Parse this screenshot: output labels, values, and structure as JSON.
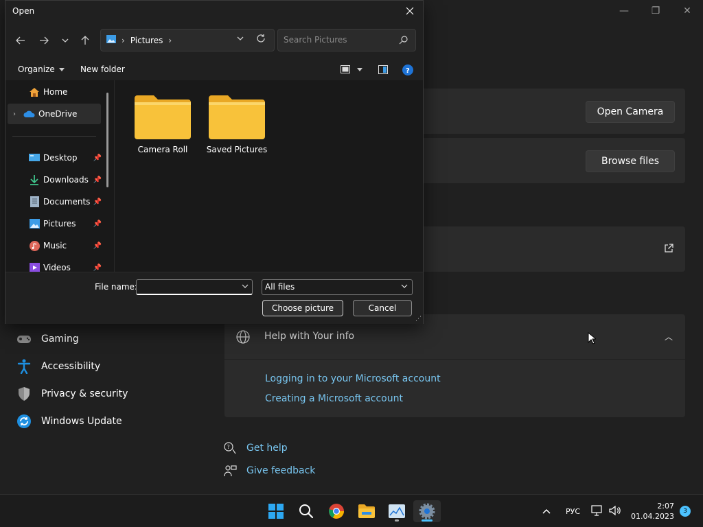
{
  "settings": {
    "window_controls": {
      "minimize": "—",
      "maximize": "❐",
      "close": "✕"
    },
    "open_camera_label": "Open Camera",
    "browse_files_label": "Browse files",
    "nav": [
      {
        "label": "Gaming",
        "icon": "gamepad-icon"
      },
      {
        "label": "Accessibility",
        "icon": "accessibility-icon"
      },
      {
        "label": "Privacy & security",
        "icon": "shield-icon"
      },
      {
        "label": "Windows Update",
        "icon": "update-icon"
      }
    ],
    "help": {
      "title": "Help with Your info",
      "links": [
        "Logging in to your Microsoft account",
        "Creating a Microsoft account"
      ]
    },
    "get_help": "Get help",
    "give_feedback": "Give feedback"
  },
  "dialog": {
    "title": "Open",
    "address": {
      "location": "Pictures"
    },
    "search": {
      "placeholder": "Search Pictures"
    },
    "toolbar": {
      "organize": "Organize",
      "new_folder": "New folder"
    },
    "sidebar": {
      "top": [
        {
          "label": "Home",
          "icon": "home-icon"
        },
        {
          "label": "OneDrive",
          "icon": "onedrive-icon"
        }
      ],
      "quick": [
        {
          "label": "Desktop",
          "icon": "desktop-icon"
        },
        {
          "label": "Downloads",
          "icon": "downloads-icon"
        },
        {
          "label": "Documents",
          "icon": "documents-icon"
        },
        {
          "label": "Pictures",
          "icon": "pictures-icon"
        },
        {
          "label": "Music",
          "icon": "music-icon"
        },
        {
          "label": "Videos",
          "icon": "videos-icon"
        }
      ]
    },
    "folders": [
      {
        "label": "Camera Roll"
      },
      {
        "label": "Saved Pictures"
      }
    ],
    "footer": {
      "file_name_label": "File name:",
      "file_name_value": "",
      "file_type": "All files",
      "choose_label": "Choose picture",
      "cancel_label": "Cancel"
    }
  },
  "taskbar": {
    "language": "РУС",
    "time": "2:07",
    "date": "01.04.2023",
    "notifications": "3"
  },
  "colors": {
    "accent": "#0078d4",
    "link": "#78c5ef",
    "folder": "#f8c23a"
  }
}
